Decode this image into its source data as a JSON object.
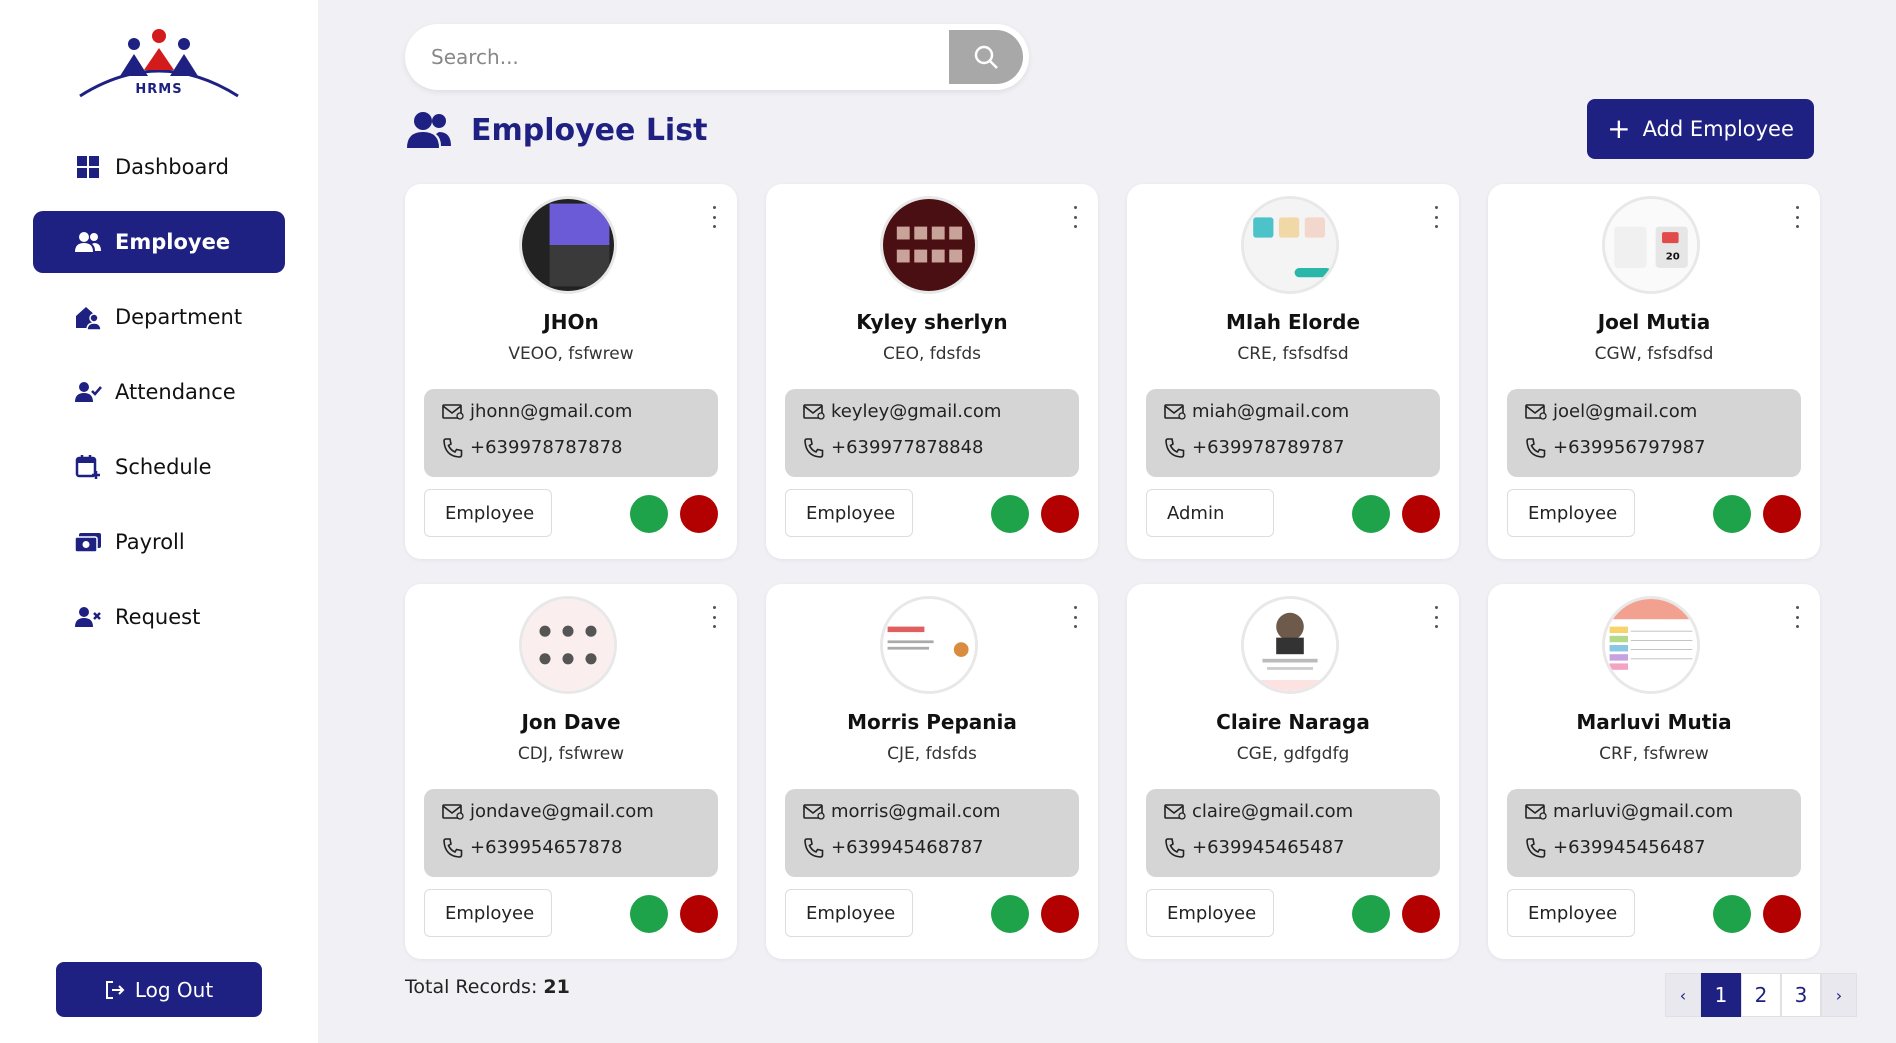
{
  "app": {
    "logo_text": "HRMS"
  },
  "sidebar": {
    "items": [
      {
        "label": "Dashboard",
        "icon": "dashboard-icon"
      },
      {
        "label": "Employee",
        "icon": "users-icon",
        "active": true
      },
      {
        "label": "Department",
        "icon": "department-icon"
      },
      {
        "label": "Attendance",
        "icon": "attendance-icon"
      },
      {
        "label": "Schedule",
        "icon": "calendar-icon"
      },
      {
        "label": "Payroll",
        "icon": "payroll-icon"
      },
      {
        "label": "Request",
        "icon": "request-icon"
      }
    ],
    "logout_label": "Log Out"
  },
  "search": {
    "placeholder": "Search..."
  },
  "header": {
    "title": "Employee List",
    "add_label": "Add Employee"
  },
  "employees": [
    {
      "name": "JHOn",
      "role": "VEOO, fsfwrew",
      "email": "jhonn@gmail.com",
      "phone": "+639978787878",
      "type": "Employee"
    },
    {
      "name": "Kyley sherlyn",
      "role": "CEO, fdsfds",
      "email": "keyley@gmail.com",
      "phone": "+639977878848",
      "type": "Employee"
    },
    {
      "name": "MIah Elorde",
      "role": "CRE, fsfsdfsd",
      "email": "miah@gmail.com",
      "phone": "+639978789787",
      "type": "Admin"
    },
    {
      "name": "Joel Mutia",
      "role": "CGW, fsfsdfsd",
      "email": "joel@gmail.com",
      "phone": "+639956797987",
      "type": "Employee"
    },
    {
      "name": "Jon Dave",
      "role": "CDJ, fsfwrew",
      "email": "jondave@gmail.com",
      "phone": "+639954657878",
      "type": "Employee"
    },
    {
      "name": "Morris Pepania",
      "role": "CJE, fdsfds",
      "email": "morris@gmail.com",
      "phone": "+639945468787",
      "type": "Employee"
    },
    {
      "name": "Claire Naraga",
      "role": "CGE, gdfgdfg",
      "email": "claire@gmail.com",
      "phone": "+639945465487",
      "type": "Employee"
    },
    {
      "name": "Marluvi Mutia",
      "role": "CRF, fsfwrew",
      "email": "marluvi@gmail.com",
      "phone": "+639945456487",
      "type": "Employee"
    }
  ],
  "footer": {
    "total_label": "Total Records:",
    "total_value": "21",
    "pages": [
      "1",
      "2",
      "3"
    ],
    "prev": "‹",
    "next": "›",
    "current_page": "1"
  },
  "colors": {
    "brand": "#1f2182",
    "approve": "#1ea34a",
    "reject": "#b30000"
  }
}
